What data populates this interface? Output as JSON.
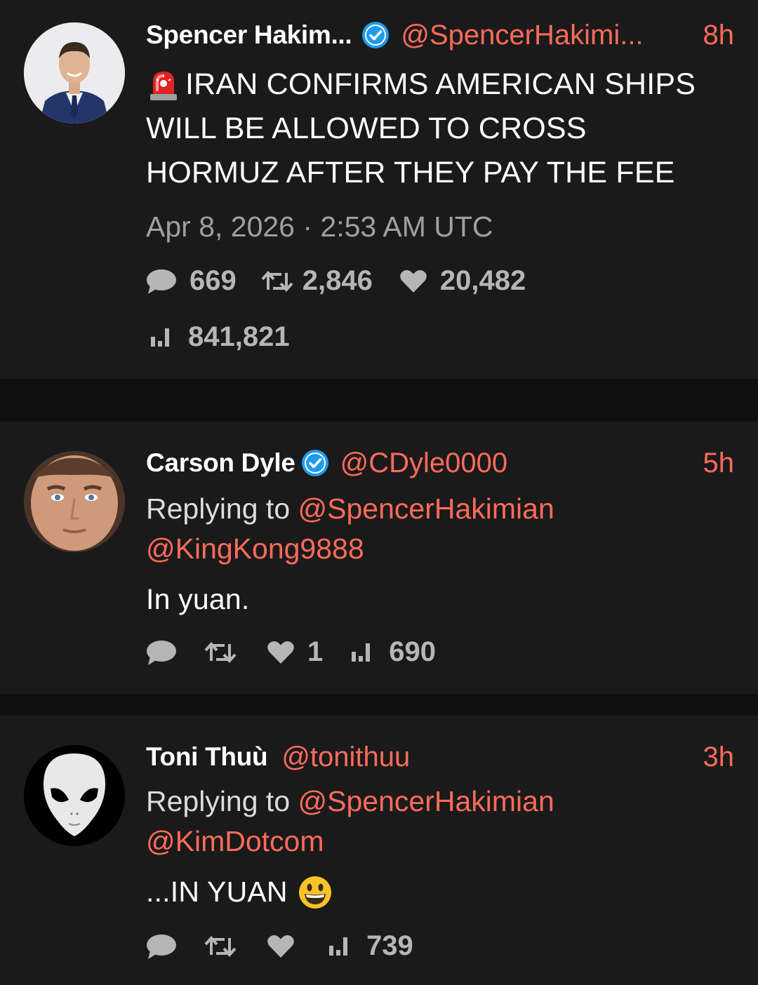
{
  "tweets": [
    {
      "name": "Spencer Hakim...",
      "handle": "@SpencerHakimi...",
      "time": "8h",
      "verified": true,
      "text_lines": [
        "IRAN CONFIRMS AMERICAN SHIPS",
        "WILL BE ALLOWED TO CROSS",
        "HORMUZ AFTER THEY PAY THE FEE"
      ],
      "leading_emoji": "police-light-icon",
      "date": "Apr 8, 2026 · 2:53 AM UTC",
      "replies": "669",
      "retweets": "2,846",
      "likes": "20,482",
      "views": "841,821"
    },
    {
      "name": "Carson Dyle",
      "handle": "@CDyle0000",
      "time": "5h",
      "verified": true,
      "replying_prefix": "Replying to",
      "replying_to": [
        "@SpencerHakimian",
        "@KingKong9888"
      ],
      "text": "In yuan.",
      "likes": "1",
      "views": "690"
    },
    {
      "name": "Toni Thuù",
      "handle": "@tonithuu",
      "time": "3h",
      "verified": false,
      "replying_prefix": "Replying to",
      "replying_to": [
        "@SpencerHakimian",
        "@KimDotcom"
      ],
      "text": "...IN YUAN",
      "trailing_emoji": "grinning-face-icon",
      "views": "739"
    }
  ],
  "colors": {
    "background": "#0f0f0f",
    "card": "#1a1a1a",
    "accent": "#ff6b5b",
    "verified": "#1d9bf0",
    "muted": "#a0a0a0"
  }
}
